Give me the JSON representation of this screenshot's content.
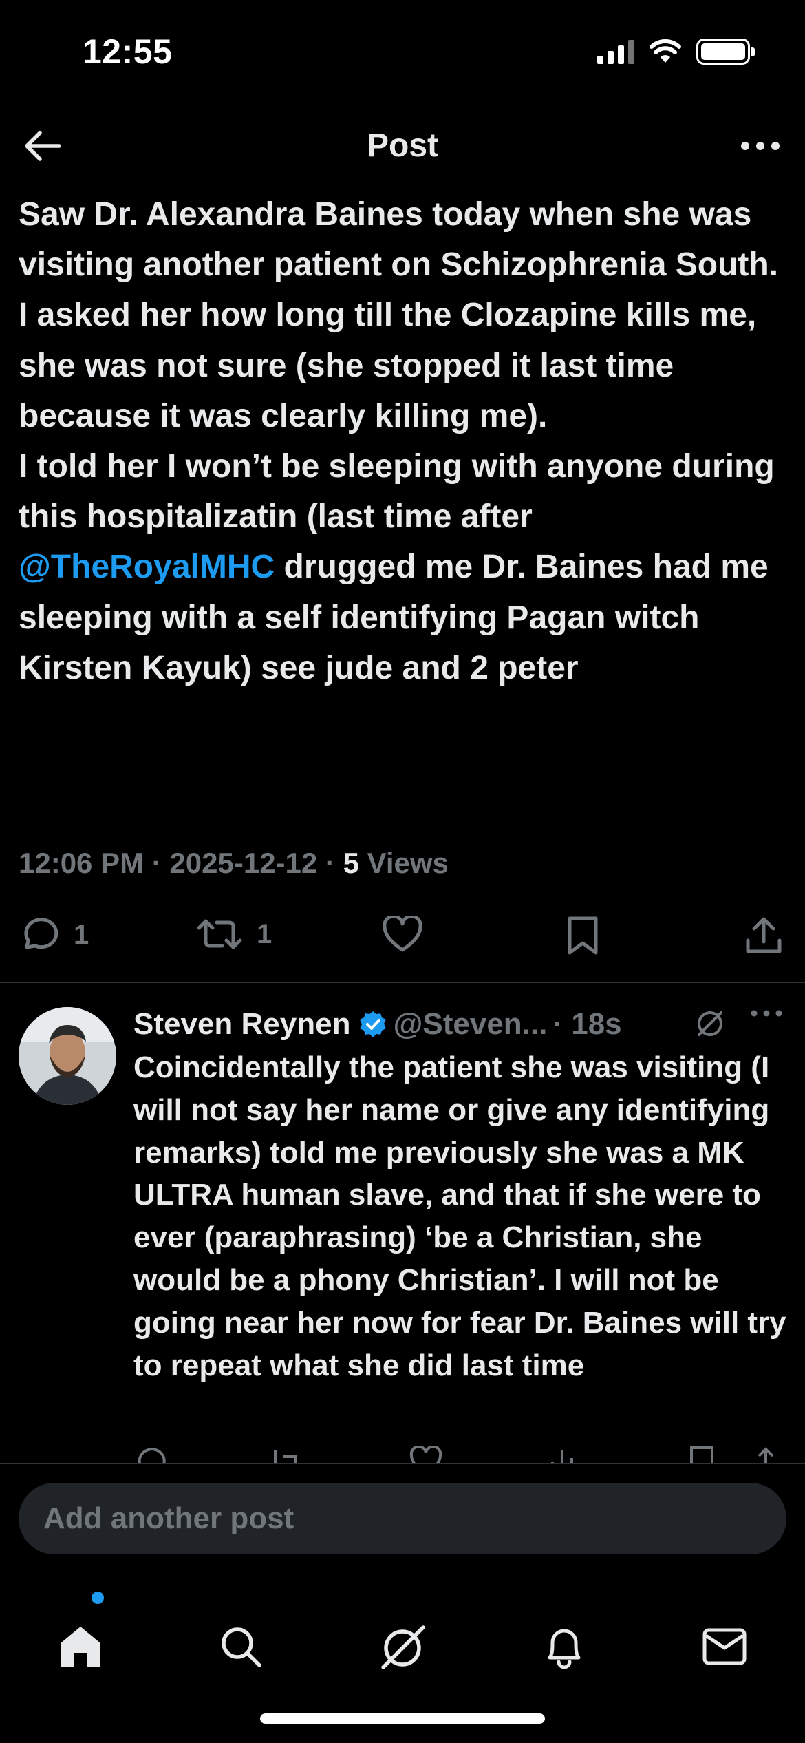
{
  "status_bar": {
    "time": "12:55"
  },
  "header": {
    "title": "Post"
  },
  "post": {
    "text_before_mention": "Saw Dr. Alexandra Baines today when she was visiting another patient on Schizophrenia South. I asked her how long till the Clozapine kills me, she was not sure (she stopped it last time because it was clearly killing me).\nI told her I won’t be sleeping with anyone during this hospitalizatin (last time after ",
    "mention": "@TheRoyalMHC",
    "text_after_mention": " drugged me Dr. Baines had me sleeping with a self identifying Pagan witch Kirsten Kayuk) see jude and 2 peter",
    "timestamp": "12:06 PM · 2025-12-12 · ",
    "views_count": "5",
    "views_label": " Views",
    "reply_count": "1",
    "repost_count": "1"
  },
  "reply": {
    "name": "Steven Reynen",
    "handle": "@Steven...",
    "time": "· 18s",
    "text": "Coincidentally the patient she was visiting (I will not say her name or give any identifying remarks) told me previously she was a MK ULTRA human slave, and that if she were to ever (paraphrasing) ‘be a Christian, she would be a phony Christian’. I will not be going near her now for fear Dr. Baines will try to repeat what she did last time"
  },
  "compose": {
    "placeholder": "Add another post"
  },
  "colors": {
    "accent": "#1d9bf0",
    "muted": "#71767b",
    "text": "#e7e9ea",
    "background": "#000000"
  },
  "icons": [
    "back-arrow-icon",
    "more-icon",
    "reply-icon",
    "repost-icon",
    "like-icon",
    "bookmark-icon",
    "share-icon",
    "verified-badge-icon",
    "grok-icon",
    "home-icon",
    "search-icon",
    "notifications-icon",
    "messages-icon"
  ]
}
